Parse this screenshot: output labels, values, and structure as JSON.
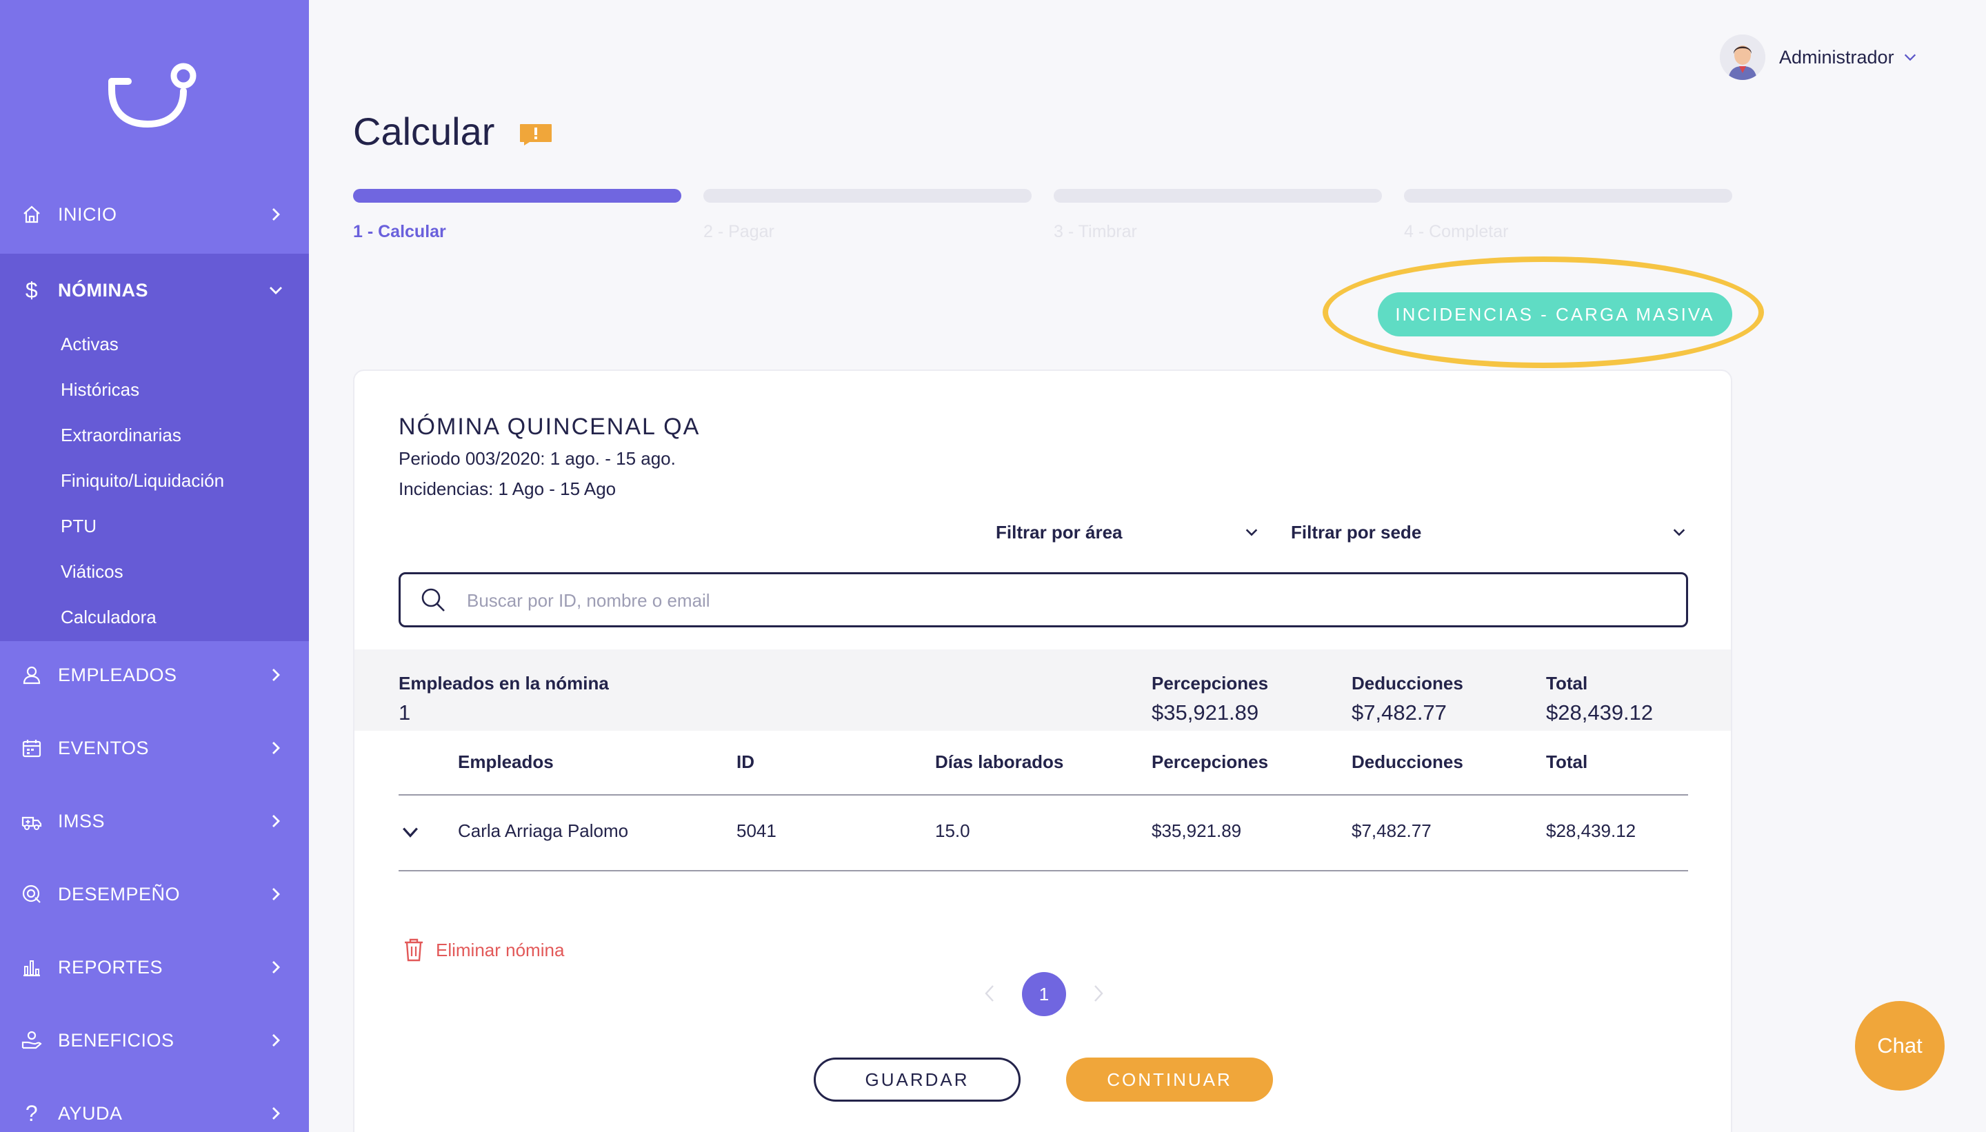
{
  "sidebar": {
    "items": [
      {
        "label": "INICIO"
      },
      {
        "label": "NÓMINAS"
      },
      {
        "label": "EMPLEADOS"
      },
      {
        "label": "EVENTOS"
      },
      {
        "label": "IMSS"
      },
      {
        "label": "DESEMPEÑO"
      },
      {
        "label": "REPORTES"
      },
      {
        "label": "BENEFICIOS"
      },
      {
        "label": "AYUDA"
      }
    ],
    "nominas_sub": [
      "Activas",
      "Históricas",
      "Extraordinarias",
      "Finiquito/Liquidación",
      "PTU",
      "Viáticos",
      "Calculadora"
    ]
  },
  "user": {
    "name": "Administrador"
  },
  "page": {
    "title": "Calcular"
  },
  "steps": [
    "1 - Calcular",
    "2 - Pagar",
    "3 - Timbrar",
    "4 - Completar"
  ],
  "actions": {
    "bulk": "INCIDENCIAS - CARGA MASIVA"
  },
  "payroll": {
    "title": "NÓMINA QUINCENAL QA",
    "period": "Periodo 003/2020: 1 ago. - 15 ago.",
    "incidences": "Incidencias: 1 Ago - 15 Ago",
    "filter_area": "Filtrar por área",
    "filter_sede": "Filtrar por sede",
    "search_placeholder": "Buscar por ID, nombre o email"
  },
  "summary": {
    "employees_label": "Empleados en la nómina",
    "employees_value": "1",
    "perc_label": "Percepciones",
    "perc_value": "$35,921.89",
    "ded_label": "Deducciones",
    "ded_value": "$7,482.77",
    "total_label": "Total",
    "total_value": "$28,439.12"
  },
  "table": {
    "headers": [
      "Empleados",
      "ID",
      "Días laborados",
      "Percepciones",
      "Deducciones",
      "Total"
    ],
    "rows": [
      [
        "Carla Arriaga Palomo",
        "5041",
        "15.0",
        "$35,921.89",
        "$7,482.77",
        "$28,439.12"
      ]
    ]
  },
  "delete_label": "Eliminar nómina",
  "pagination": {
    "current": "1"
  },
  "buttons": {
    "save": "GUARDAR",
    "continue": "CONTINUAR"
  },
  "chat": "Chat",
  "colors": {
    "sidebar": "#7b72ea",
    "accent": "#7066e0",
    "teal": "#5fdcc4",
    "orange": "#f0a63a",
    "highlight": "#f6c443",
    "danger": "#e25858"
  }
}
